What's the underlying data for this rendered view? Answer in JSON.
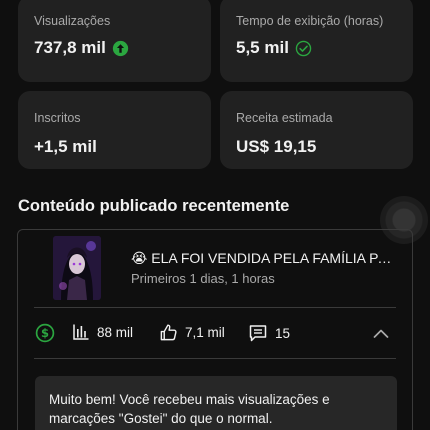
{
  "stats": {
    "views": {
      "label": "Visualizações",
      "value": "737,8 mil",
      "trend_icon": "arrow-up-circle-icon",
      "trend_color": "#2ba640"
    },
    "watch_time": {
      "label": "Tempo de exibição (horas)",
      "value": "5,5 mil",
      "status_icon": "check-circle-icon",
      "status_color": "#2ba640"
    },
    "subscribers": {
      "label": "Inscritos",
      "value": "+1,5 mil"
    },
    "revenue": {
      "label": "Receita estimada",
      "value": "US$ 19,15"
    }
  },
  "recent": {
    "section_title": "Conteúdo publicado recentemente",
    "video": {
      "title": "😭 ELA FOI VENDIDA PELA FAMÍLIA PARA ...",
      "subtitle": "Primeiros 1 dias, 1 horas",
      "thumbnail_icon": "video-thumbnail",
      "metrics": {
        "monetization_icon": "dollar-circle-icon",
        "monetization_color": "#2ba640",
        "views": "88 mil",
        "likes": "7,1 mil",
        "comments": "15"
      },
      "tip": "Muito bem! Você recebeu mais visualizações e marcações \"Gostei\" do que o normal."
    }
  }
}
